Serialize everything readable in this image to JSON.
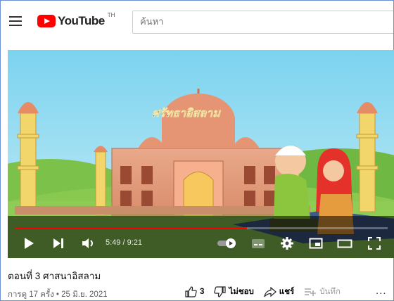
{
  "header": {
    "logo_text": "YouTube",
    "logo_region": "TH",
    "search_placeholder": "ค้นหา"
  },
  "player": {
    "overlay_title": "ศรัทธาอิสลาม",
    "current_time": "5:49",
    "duration": "9:21",
    "time_separator": " / ",
    "progress": 0.622,
    "accent_color": "#ff0000"
  },
  "video": {
    "title": "ตอนที่ 3 ศาสนาอิสลาม",
    "meta": "การดู 17 ครั้ง • 25 มิ.ย. 2021",
    "like_count": "3",
    "dislike_label": "ไม่ชอบ",
    "share_label": "แชร์",
    "save_label": "บันทึก",
    "more_label": "..."
  },
  "icons": [
    "menu-icon",
    "youtube-logo-icon",
    "play-icon",
    "next-icon",
    "volume-icon",
    "autoplay-toggle-icon",
    "subtitles-icon",
    "settings-icon",
    "miniplayer-icon",
    "theater-icon",
    "fullscreen-icon",
    "like-icon",
    "dislike-icon",
    "share-icon",
    "save-icon",
    "more-icon"
  ]
}
